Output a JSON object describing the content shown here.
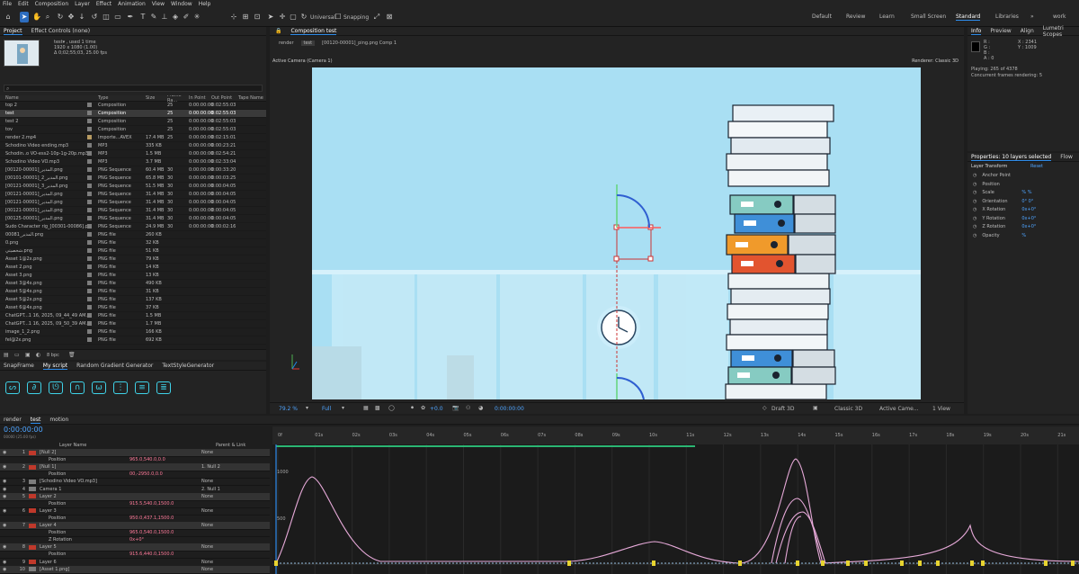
{
  "menu": [
    "File",
    "Edit",
    "Composition",
    "Layer",
    "Effect",
    "Animation",
    "View",
    "Window",
    "Help"
  ],
  "toolbar": {
    "universal_label": "Universal",
    "snapping_label": "Snapping",
    "workspaces": [
      "Default",
      "Review",
      "Learn",
      "Small Screen",
      "Standard",
      "Libraries",
      "»",
      "work"
    ],
    "active_workspace": "Standard"
  },
  "project": {
    "tabs": [
      "Project",
      "Effect Controls (none)"
    ],
    "active_tab": "Project",
    "thumb_info": [
      "test▾ , used 1 time",
      "1920 x 1080 (1.00)",
      "Δ 0;02;55;03, 25.00 fps"
    ],
    "columns": [
      "Name",
      "",
      "Type",
      "Size",
      "Frame Ra...",
      "In Point",
      "Out Point",
      "Tape Name"
    ],
    "rows": [
      {
        "name": "top 2",
        "label": "#7d7d7d",
        "type": "Composition",
        "size": "",
        "fps": "25",
        "in": "0:00:00:00",
        "out": "0:02:55:03"
      },
      {
        "name": "test",
        "label": "#7d7d7d",
        "type": "Composition",
        "size": "",
        "fps": "25",
        "in": "0:00:00:00",
        "out": "0:02:55:03",
        "selected": true
      },
      {
        "name": "test 2",
        "label": "#7d7d7d",
        "type": "Composition",
        "size": "",
        "fps": "25",
        "in": "0:00:00:00",
        "out": "0:02:55:03"
      },
      {
        "name": "tov",
        "label": "#7d7d7d",
        "type": "Composition",
        "size": "",
        "fps": "25",
        "in": "0:00:00:00",
        "out": "0:02:55:03"
      },
      {
        "name": "render 2.mp4",
        "label": "#b79b62",
        "type": "Importe...AVEX",
        "size": "17.4 MB",
        "fps": "25",
        "in": "0:00:00:00",
        "out": "0:02:15:01"
      },
      {
        "name": "Schodino Video ending.mp3",
        "label": "#7d7d7d",
        "type": "MP3",
        "size": "335 KB",
        "fps": "",
        "in": "0:00:00:00",
        "out": "0:00:23:21"
      },
      {
        "name": "Schodin..o VO-ess2-10p-1g-20p.mp3",
        "label": "#7d7d7d",
        "type": "MP3",
        "size": "1.5 MB",
        "fps": "",
        "in": "0:00:00:00",
        "out": "0:02:54:21"
      },
      {
        "name": "Schodino Video VO.mp3",
        "label": "#7d7d7d",
        "type": "MP3",
        "size": "3.7 MB",
        "fps": "",
        "in": "0:00:00:00",
        "out": "0:02:33:04"
      },
      {
        "name": "[00120-00001]_المدير.png",
        "label": "#7d7d7d",
        "type": "PNG Sequence",
        "size": "60.4 MB",
        "fps": "30",
        "in": "0:00:00:00",
        "out": "0:00:33:20"
      },
      {
        "name": "[00101-00001]_المدير_2.png",
        "label": "#7d7d7d",
        "type": "PNG Sequence",
        "size": "65.8 MB",
        "fps": "30",
        "in": "0:00:00:00",
        "out": "0:00:03:25"
      },
      {
        "name": "[00121-00001]_المدير_3.png",
        "label": "#7d7d7d",
        "type": "PNG Sequence",
        "size": "51.5 MB",
        "fps": "30",
        "in": "0:00:00:00",
        "out": "0:00:04:05"
      },
      {
        "name": "[00121-00001]_المدير.png",
        "label": "#7d7d7d",
        "type": "PNG Sequence",
        "size": "31.4 MB",
        "fps": "30",
        "in": "0:00:00:00",
        "out": "0:00:04:05"
      },
      {
        "name": "[00121-00001]_المدير.png",
        "label": "#7d7d7d",
        "type": "PNG Sequence",
        "size": "31.4 MB",
        "fps": "30",
        "in": "0:00:00:00",
        "out": "0:00:04:05"
      },
      {
        "name": "[00121-00001]_المدير.png",
        "label": "#7d7d7d",
        "type": "PNG Sequence",
        "size": "31.4 MB",
        "fps": "30",
        "in": "0:00:00:00",
        "out": "0:00:04:05"
      },
      {
        "name": "[00125-00001]_المدير.png",
        "label": "#7d7d7d",
        "type": "PNG Sequence",
        "size": "31.4 MB",
        "fps": "30",
        "in": "0:00:00:00",
        "out": "0:00:04:05"
      },
      {
        "name": "Sudo Character rig_[00301-00086].png",
        "label": "#7d7d7d",
        "type": "PNG Sequence",
        "size": "24.9 MB",
        "fps": "30",
        "in": "0:00:00:00",
        "out": "0:00:02:16"
      },
      {
        "name": "00081_المدير.png",
        "label": "#7d7d7d",
        "type": "PNG file",
        "size": "260 KB",
        "fps": "",
        "in": "",
        "out": ""
      },
      {
        "name": "0.png",
        "label": "#7d7d7d",
        "type": "PNG file",
        "size": "32 KB",
        "fps": "",
        "in": "",
        "out": ""
      },
      {
        "name": "شخصيتي.png",
        "label": "#7d7d7d",
        "type": "PNG file",
        "size": "51 KB",
        "fps": "",
        "in": "",
        "out": ""
      },
      {
        "name": "Asset 1@2x.png",
        "label": "#7d7d7d",
        "type": "PNG file",
        "size": "79 KB",
        "fps": "",
        "in": "",
        "out": ""
      },
      {
        "name": "Asset 2.png",
        "label": "#7d7d7d",
        "type": "PNG file",
        "size": "14 KB",
        "fps": "",
        "in": "",
        "out": ""
      },
      {
        "name": "Asset 3.png",
        "label": "#7d7d7d",
        "type": "PNG file",
        "size": "13 KB",
        "fps": "",
        "in": "",
        "out": ""
      },
      {
        "name": "Asset 3@4x.png",
        "label": "#7d7d7d",
        "type": "PNG file",
        "size": "490 KB",
        "fps": "",
        "in": "",
        "out": ""
      },
      {
        "name": "Asset 5@4x.png",
        "label": "#7d7d7d",
        "type": "PNG file",
        "size": "31 KB",
        "fps": "",
        "in": "",
        "out": ""
      },
      {
        "name": "Asset 5@2x.png",
        "label": "#7d7d7d",
        "type": "PNG file",
        "size": "137 KB",
        "fps": "",
        "in": "",
        "out": ""
      },
      {
        "name": "Asset 6@4x.png",
        "label": "#7d7d7d",
        "type": "PNG file",
        "size": "37 KB",
        "fps": "",
        "in": "",
        "out": ""
      },
      {
        "name": "ChatGPT...1 16, 2025, 09_44_49 AM.png",
        "label": "#7d7d7d",
        "type": "PNG file",
        "size": "1.5 MB",
        "fps": "",
        "in": "",
        "out": ""
      },
      {
        "name": "ChatGPT...1 16, 2025, 09_50_39 AM.png",
        "label": "#7d7d7d",
        "type": "PNG file",
        "size": "1.7 MB",
        "fps": "",
        "in": "",
        "out": ""
      },
      {
        "name": "image_1_2.png",
        "label": "#7d7d7d",
        "type": "PNG file",
        "size": "166 KB",
        "fps": "",
        "in": "",
        "out": ""
      },
      {
        "name": "fel@2x.png",
        "label": "#7d7d7d",
        "type": "PNG file",
        "size": "692 KB",
        "fps": "",
        "in": "",
        "out": ""
      }
    ],
    "bpc": "8 bpc"
  },
  "scripts": {
    "tabs": [
      "SnapFrame",
      "My script",
      "Random Gradient Generator",
      "TextStyleGenerator"
    ],
    "active_tab": "My script"
  },
  "viewer": {
    "tab": "Composition test",
    "breadcrumb": [
      "render",
      "test",
      "[00120-00001]_ping.png Comp 1"
    ],
    "active_camera": "Active Camera (Camera 1)",
    "renderer": "Renderer: Classic 3D",
    "zoom": "79.2 %",
    "quality": "Full",
    "exposure": "+0.0",
    "timecode": "0:00:00:00",
    "draft_label": "Draft 3D",
    "renderer_dropdown": "Classic 3D",
    "camera_dropdown": "Active Came...",
    "view_dropdown": "1 View"
  },
  "info": {
    "tabs": [
      "Info",
      "Preview",
      "Align",
      "Lumetri Scopes"
    ],
    "active_tab": "Info",
    "r": "R :",
    "g": "G :",
    "b": "B :",
    "a": "A : 0",
    "x": "X : 2341",
    "y": "Y : 1009",
    "playing": "Playing: 265 of 4378",
    "concurrent": "Concurrent frames rendering: 5"
  },
  "properties": {
    "tabs": [
      "Properties: 10 layers selected",
      "Flow"
    ],
    "active_tab": "Properties: 10 layers selected",
    "section": "Layer Transform",
    "reset": "Reset",
    "items": [
      {
        "name": "Anchor Point",
        "value": ""
      },
      {
        "name": "Position",
        "value": ""
      },
      {
        "name": "Scale",
        "value": "%       %"
      },
      {
        "name": "Orientation",
        "value": "0°    0°"
      },
      {
        "name": "X Rotation",
        "value": "0x+0°"
      },
      {
        "name": "Y Rotation",
        "value": "0x+0°"
      },
      {
        "name": "Z Rotation",
        "value": "0x+0°"
      },
      {
        "name": "Opacity",
        "value": "%"
      }
    ]
  },
  "timeline": {
    "tabs": [
      "render",
      "test",
      "motion"
    ],
    "active_tab": "test",
    "timecode": "0:00:00:00",
    "fps_sub": "00000 (25.00 fps)",
    "col_layer_name": "Layer Name",
    "col_parent": "Parent & Link",
    "layers": [
      {
        "num": "1",
        "name": "[Null 2]",
        "color": "#c0392b",
        "parent": "None",
        "selected": true
      },
      {
        "num": "",
        "name": "Position",
        "value": "965.0,540.0,0.0",
        "parent": ""
      },
      {
        "num": "2",
        "name": "[Null 1]",
        "color": "#c0392b",
        "parent": "1. Null 2",
        "selected": true
      },
      {
        "num": "",
        "name": "Position",
        "value": "00,-2950.0,0.0",
        "parent": ""
      },
      {
        "num": "3",
        "name": "[Schodino Video VO.mp3]",
        "color": "#7d7d7d",
        "parent": "None"
      },
      {
        "num": "4",
        "name": "Camera 1",
        "color": "#7d7d7d",
        "parent": "2. Null 1"
      },
      {
        "num": "5",
        "name": "Layer 2",
        "color": "#c0392b",
        "parent": "None",
        "selected": true
      },
      {
        "num": "",
        "name": "Position",
        "value": "915.5,540.0,1500.0",
        "parent": ""
      },
      {
        "num": "6",
        "name": "Layer 3",
        "color": "#c0392b",
        "parent": "None"
      },
      {
        "num": "",
        "name": "Position",
        "value": "950.0,437.1,1500.0",
        "parent": ""
      },
      {
        "num": "7",
        "name": "Layer 4",
        "color": "#c0392b",
        "parent": "None",
        "selected": true
      },
      {
        "num": "",
        "name": "Position",
        "value": "965.0,540.0,1500.0",
        "parent": ""
      },
      {
        "num": "",
        "name": "Z Rotation",
        "value": "0x+0°",
        "parent": ""
      },
      {
        "num": "8",
        "name": "Layer 5",
        "color": "#c0392b",
        "parent": "None",
        "selected": true
      },
      {
        "num": "",
        "name": "Position",
        "value": "915.6,440.0,1500.0",
        "parent": ""
      },
      {
        "num": "9",
        "name": "Layer 6",
        "color": "#c0392b",
        "parent": "None"
      },
      {
        "num": "10",
        "name": "[Asset 1.png]",
        "color": "#7d7d7d",
        "parent": "None",
        "selected": true
      }
    ],
    "ruler": [
      "0f",
      "01s",
      "02s",
      "03s",
      "04s",
      "05s",
      "06s",
      "07s",
      "08s",
      "09s",
      "10s",
      "11s",
      "12s",
      "13s",
      "14s",
      "15s",
      "16s",
      "17s",
      "18s",
      "19s",
      "20s",
      "21s"
    ],
    "graph_labels": [
      "1000",
      "500"
    ]
  },
  "colors": {
    "accent": "#2d8ceb",
    "selection": "#3a3a3a",
    "curve": "#e6a9d8",
    "keyframe": "#e8d430"
  }
}
